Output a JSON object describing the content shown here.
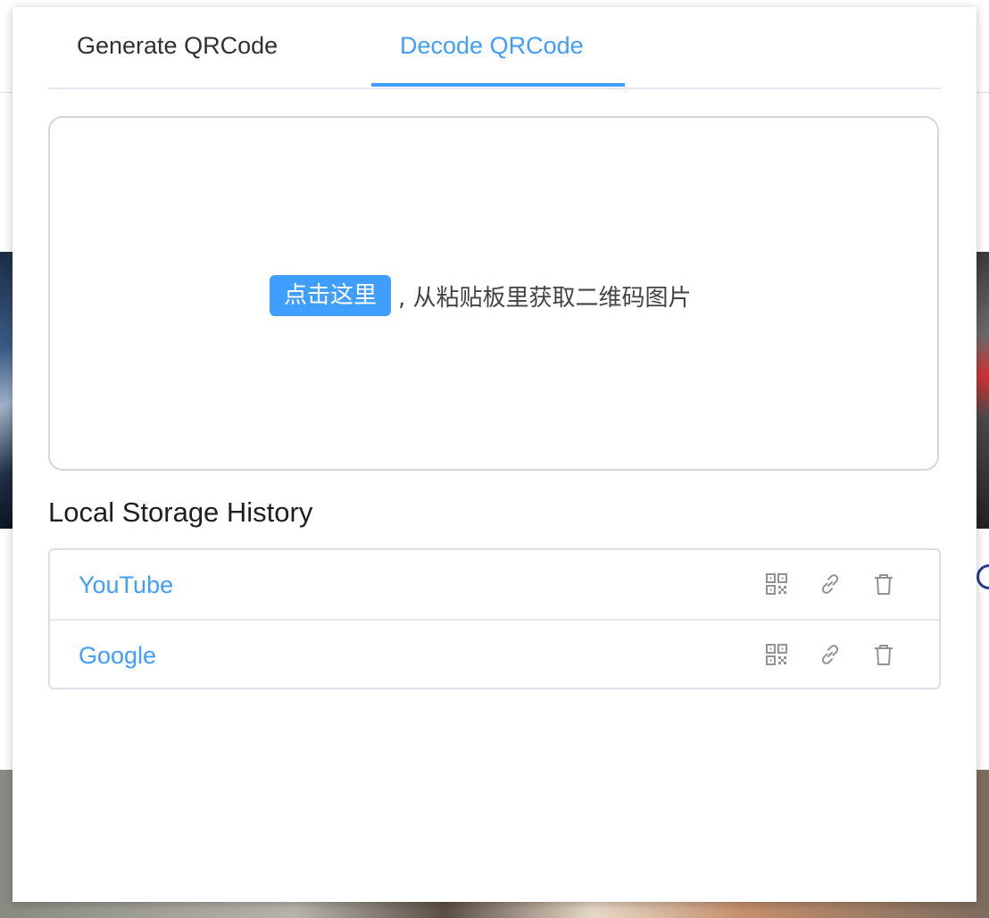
{
  "tabs": {
    "generate_label": "Generate QRCode",
    "decode_label": "Decode QRCode",
    "active": "decode"
  },
  "decode": {
    "paste_button_label": "点击这里",
    "paste_hint": ", 从粘贴板里获取二维码图片"
  },
  "history": {
    "title": "Local Storage History",
    "items": [
      {
        "label": "YouTube",
        "icons": [
          "qrcode-icon",
          "link-icon",
          "trash-icon"
        ]
      },
      {
        "label": "Google",
        "icons": [
          "qrcode-icon",
          "link-icon",
          "trash-icon"
        ]
      }
    ]
  },
  "colors": {
    "accent": "#409eff",
    "text": "#303133",
    "border": "#dcdfe6",
    "icon": "#909399"
  }
}
